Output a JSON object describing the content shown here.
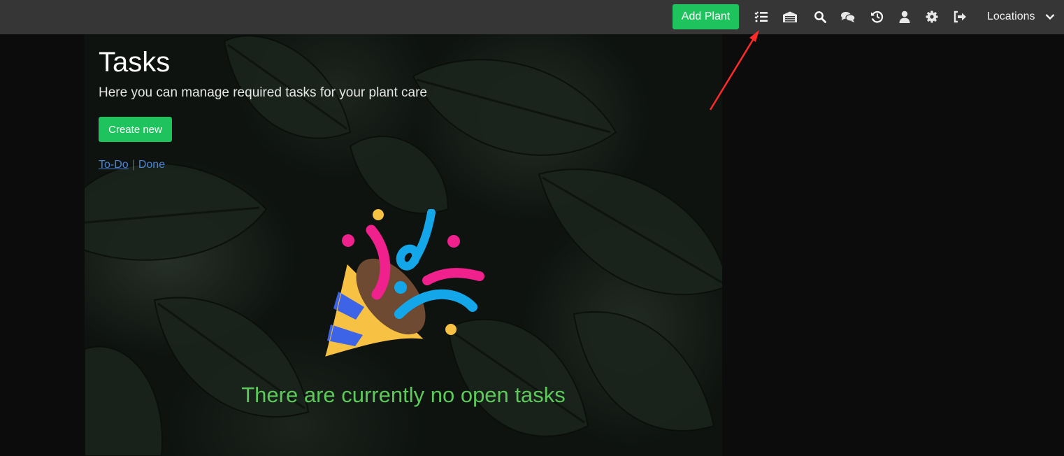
{
  "navbar": {
    "add_plant_label": "Add Plant",
    "icons": [
      "tasks-icon",
      "inventory-icon",
      "search-icon",
      "chat-icon",
      "history-icon",
      "user-icon",
      "gear-icon",
      "logout-icon"
    ],
    "locations_label": "Locations"
  },
  "page": {
    "title": "Tasks",
    "subtitle": "Here you can manage required tasks for your plant care",
    "create_label": "Create new",
    "filters": {
      "todo": "To-Do",
      "separator": "|",
      "done": "Done"
    },
    "empty_message": "There are currently no open tasks"
  },
  "colors": {
    "navbar_bg": "#363636",
    "accent_green": "#1fc35d",
    "empty_text": "#5cc95a",
    "link": "#4a83d6",
    "annotation_arrow": "#ff2a2a"
  }
}
